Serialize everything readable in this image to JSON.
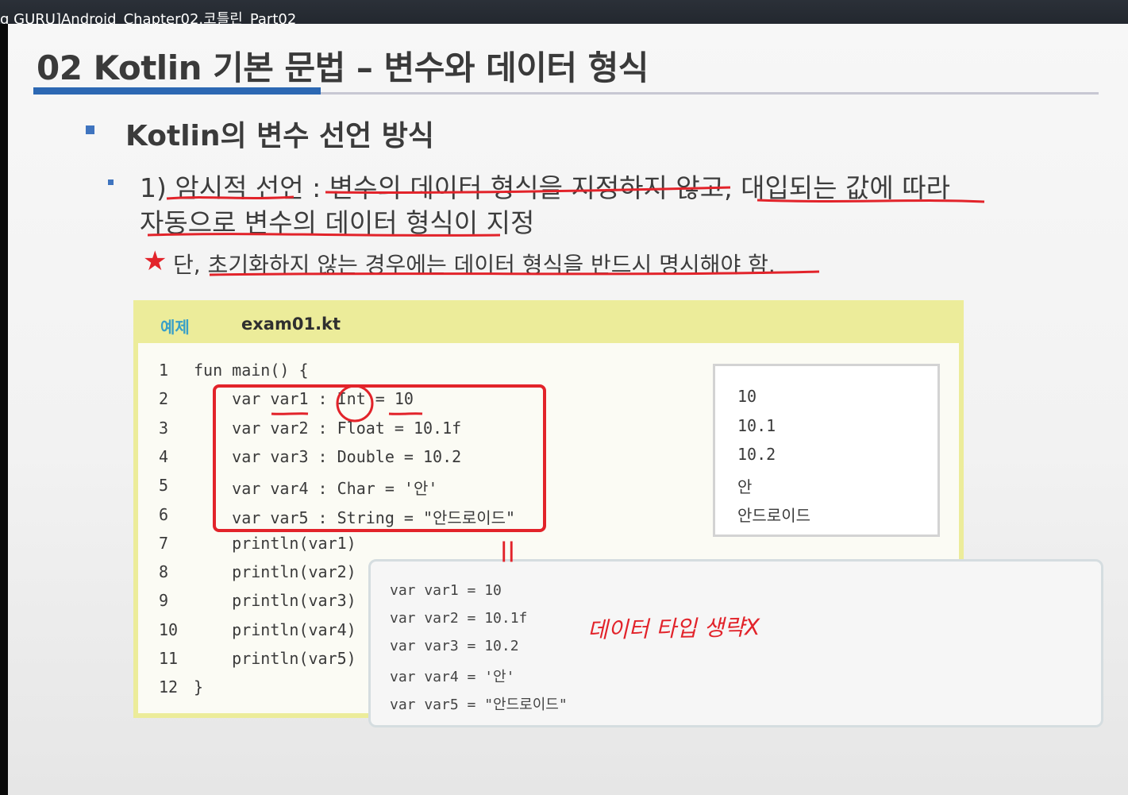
{
  "window": {
    "title": "g GURU]Android_Chapter02.코틀린_Part02"
  },
  "slide": {
    "title": "02 Kotlin 기본 문법 – 변수와 데이터 형식",
    "heading": "Kotlin의 변수 선언 방식",
    "point1_line1": "1) 암시적 선언 : 변수의 데이터 형식을 지정하지 않고, 대입되는 값에 따라",
    "point1_line2": "자동으로 변수의 데이터 형식이 지정",
    "note": "단, 초기화하지 않는 경우에는 데이터 형식을 반드시 명시해야 함."
  },
  "example": {
    "tag": "예제",
    "filename": "exam01.kt",
    "code": [
      {
        "n": "1",
        "t": "fun main() {"
      },
      {
        "n": "2",
        "t": "    var var1 : Int = 10"
      },
      {
        "n": "3",
        "t": "    var var2 : Float = 10.1f"
      },
      {
        "n": "4",
        "t": "    var var3 : Double = 10.2"
      },
      {
        "n": "5",
        "t": "    var var4 : Char = '안'"
      },
      {
        "n": "6",
        "t": "    var var5 : String = \"안드로이드\""
      },
      {
        "n": "7",
        "t": "    println(var1)"
      },
      {
        "n": "8",
        "t": "    println(var2)"
      },
      {
        "n": "9",
        "t": "    println(var3)"
      },
      {
        "n": "10",
        "t": "    println(var4)"
      },
      {
        "n": "11",
        "t": "    println(var5)"
      },
      {
        "n": "12",
        "t": "}"
      }
    ],
    "output": [
      "10",
      "10.1",
      "10.2",
      "안",
      "안드로이드"
    ]
  },
  "overlay": {
    "lines": [
      "var var1 = 10",
      "var var2 = 10.1f",
      "var var3 = 10.2",
      "var var4 = '안'",
      "var var5 = \"안드로이드\""
    ],
    "handwritten_note": "데이터 타입 생략X",
    "marker": "||"
  },
  "colors": {
    "accent_blue": "#2c68b3",
    "ink_red": "#e2232a",
    "example_header": "#ecec9a"
  }
}
